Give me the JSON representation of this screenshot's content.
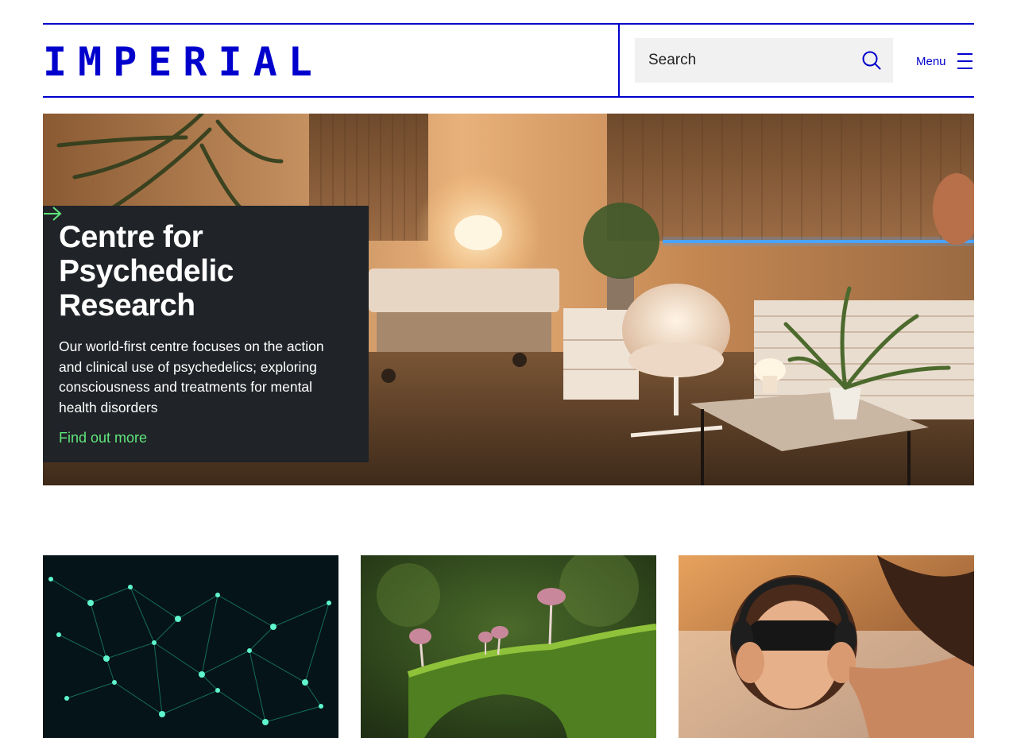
{
  "header": {
    "logo": "IMPERIAL",
    "search_placeholder": "Search",
    "menu_label": "Menu"
  },
  "hero": {
    "title": "Centre for\nPsychedelic\nResearch",
    "description": "Our world-first centre focuses on the action\nand clinical use of psychedelics; exploring\nconsciousness and treatments for mental\nhealth disorders",
    "link_label": "Find out more"
  },
  "colors": {
    "brand": "#0000cd",
    "card_bg": "#202327",
    "link_green": "#5fe67c",
    "search_bg": "#f1f1f1"
  },
  "icons": {
    "search": "search-icon",
    "menu": "hamburger-menu-icon",
    "link": "arrow-right-icon"
  }
}
